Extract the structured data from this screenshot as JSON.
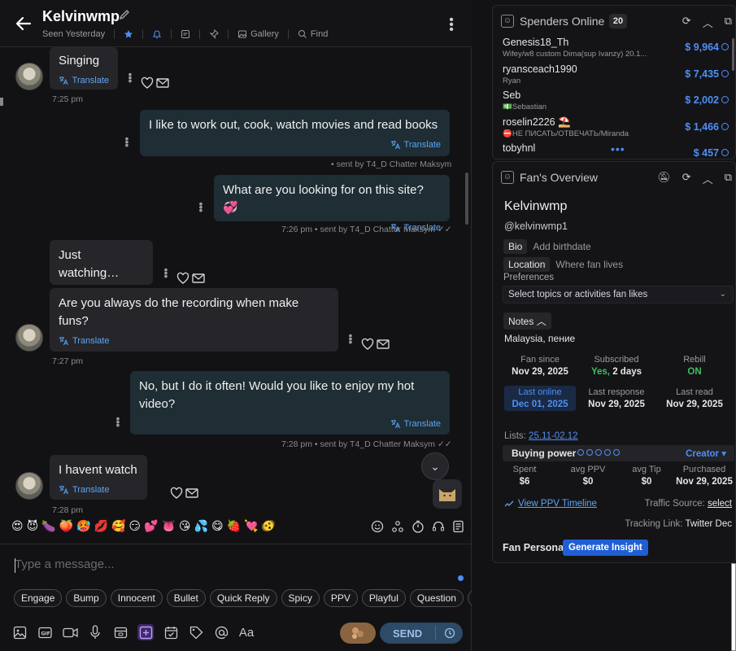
{
  "header": {
    "name": "Kelvinwmp",
    "seen": "Seen Yesterday",
    "gallery": "Gallery",
    "find": "Find"
  },
  "messages": [
    {
      "dir": "in",
      "text": "Singing",
      "translate": "Translate",
      "time": "7:25 pm"
    },
    {
      "dir": "out",
      "text": "I like to work out, cook, watch movies and read books",
      "translate": "Translate",
      "meta": "• sent by T4_D Chatter Maksym"
    },
    {
      "dir": "out",
      "text": "What are you looking for on this site? 💞",
      "translate": "Translate",
      "meta": "7:26 pm • sent by T4_D Chatter Maksym"
    },
    {
      "dir": "in",
      "text": "Just watching…",
      "translate": "Translate"
    },
    {
      "dir": "in",
      "text": "Are you always do the recording when make funs?",
      "translate": "Translate",
      "time": "7:27 pm"
    },
    {
      "dir": "out",
      "text": "No, but I do it often! Would you like to enjoy my hot video?",
      "translate": "Translate",
      "meta": "7:28 pm • sent by T4_D Chatter Maksym"
    },
    {
      "dir": "in",
      "text": "I havent watch",
      "translate": "Translate",
      "time": "7:28 pm"
    }
  ],
  "emojis": [
    "😍",
    "😈",
    "🍆",
    "🍑",
    "🥵",
    "💋",
    "🥰",
    "😏",
    "💕",
    "👅",
    "😘",
    "💦",
    "😋",
    "🍓",
    "💘",
    "🫨"
  ],
  "composer": {
    "placeholder": "Type a message..."
  },
  "chips": [
    "Engage",
    "Bump",
    "Innocent",
    "Bullet",
    "Quick Reply",
    "Spicy",
    "PPV",
    "Playful",
    "Question",
    "Upsell"
  ],
  "send_label": "SEND",
  "spenders": {
    "title": "Spenders Online",
    "count": "20",
    "items": [
      {
        "name": "Genesis18_Th",
        "sub": "Wifey/w8 custom Dima(sup Ivanzy) 20.1...",
        "amount": "$ 9,964"
      },
      {
        "name": "ryansceach1990",
        "sub": "Ryan",
        "amount": "$ 7,435"
      },
      {
        "name": "Seb",
        "sub": "💵Sebastian",
        "amount": "$ 2,002"
      },
      {
        "name": "roselin2226 ⛱️",
        "sub": "⛔НЕ ПИСАТЬ/ОТВЕЧАТЬ/Miranda",
        "amount": "$ 1,466"
      },
      {
        "name": "tobyhnl",
        "sub": "",
        "amount": "$ 457"
      }
    ]
  },
  "fan": {
    "title": "Fan's Overview",
    "name": "Kelvinwmp",
    "handle": "@kelvinwmp1",
    "bio_tag": "Bio",
    "bio_hint": "Add birthdate",
    "location_tag": "Location",
    "location_hint": "Where fan lives",
    "preferences_label": "Preferences",
    "preferences_placeholder": "Select topics or activities fan likes",
    "notes_tag": "Notes",
    "notes_text": "Malaysia, пение",
    "stats_row1": [
      {
        "label": "Fan since",
        "value": "Nov 29, 2025"
      },
      {
        "label": "Subscribed",
        "value_prefix": "Yes,",
        "value": " 2 days"
      },
      {
        "label": "Rebill",
        "value": "ON"
      }
    ],
    "stats_row2": [
      {
        "label": "Last online",
        "value": "Dec 01, 2025"
      },
      {
        "label": "Last response",
        "value": "Nov 29, 2025"
      },
      {
        "label": "Last read",
        "value": "Nov 29, 2025"
      }
    ],
    "lists_label": "Lists:",
    "lists_value": "25.11-02.12",
    "buying_power_label": "Buying power",
    "buying_power_tier": "Creator ▾",
    "money": [
      {
        "label": "Spent",
        "value": "$6"
      },
      {
        "label": "avg PPV",
        "value": "$0"
      },
      {
        "label": "avg Tip",
        "value": "$0"
      },
      {
        "label": "Purchased",
        "value": "Nov 29, 2025"
      }
    ],
    "ppv_link": "View PPV Timeline",
    "traffic_label": "Traffic Source:",
    "traffic_value": "select",
    "tracking_label": "Tracking Link:",
    "tracking_value": "Twitter Dec",
    "persona_label": "Fan Persona",
    "generate_label": "Generate Insight"
  }
}
